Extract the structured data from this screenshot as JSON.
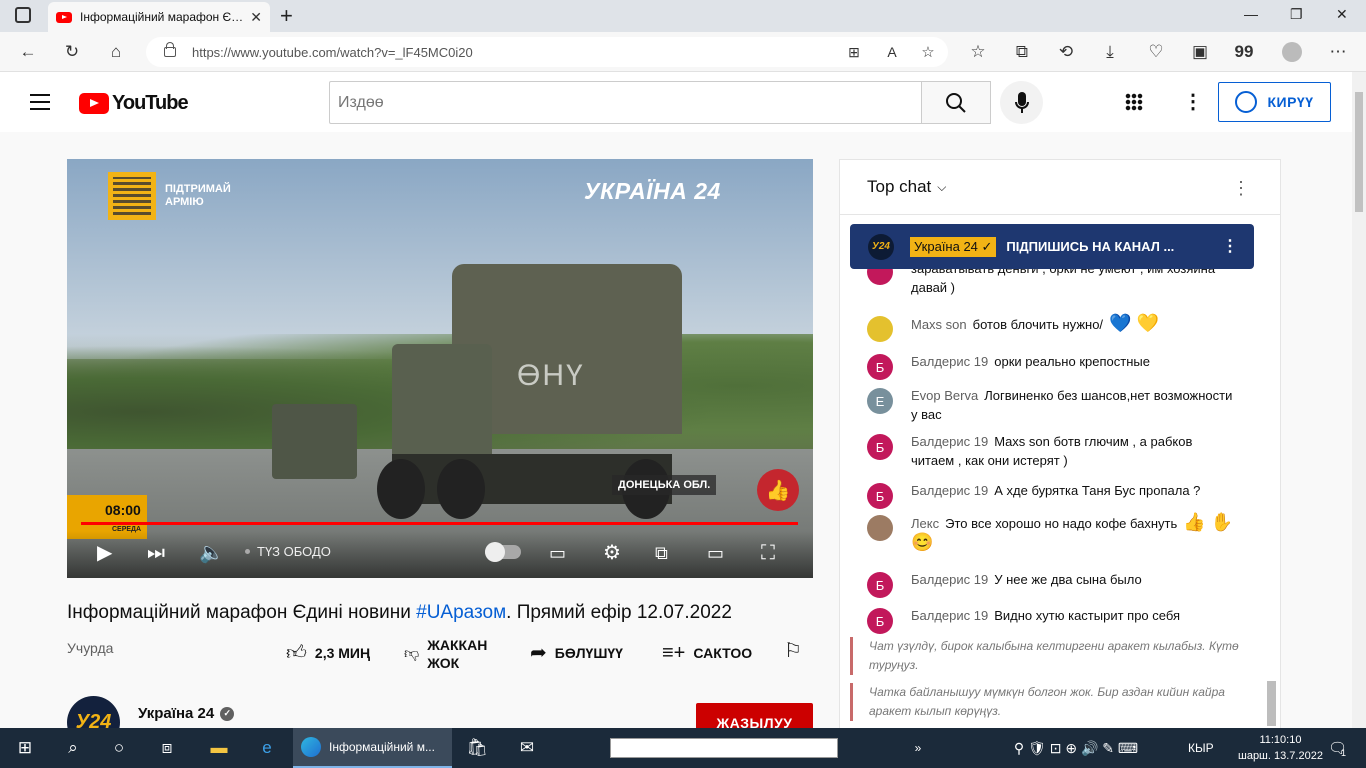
{
  "browser": {
    "tab_title": "Інформаційний марафон Єди",
    "url": "https://www.youtube.com/watch?v=_lF45MC0i20"
  },
  "youtube": {
    "logo_text": "YouTube",
    "search_placeholder": "Издөө",
    "login_label": "КИРҮҮ"
  },
  "video": {
    "qr_text_1": "ПІДТРИМАЙ",
    "qr_text_2": "АРМІЮ",
    "channel_watermark": "УКРАЇНА 24",
    "region": "ДОНЕЦЬКА ОБЛ.",
    "truck_label": "ӨНҮ",
    "overlay_time": "08:00",
    "overlay_day": "СЕРЕДА",
    "live_label": "ТҮЗ ОБОДО",
    "title_prefix": "Інформаційний марафон Єдині новини ",
    "title_tag": "#UAразом",
    "title_suffix": ". Прямий ефір 12.07.2022",
    "date_label": "Учурда",
    "likes": "2,3 МИҢ",
    "dislike_label_1": "ЖАККАН",
    "dislike_label_2": "ЖОК",
    "share_label": "БӨЛҮШҮҮ",
    "save_label": "САКТОО",
    "channel_name": "Україна 24",
    "channel_avatar_text": "У24",
    "subscribe_label": "ЖАЗЫЛУУ"
  },
  "chat": {
    "header": "Top chat",
    "pinned": {
      "avatar": "У24",
      "author": "Україна 24 ✓",
      "text": "ПІДПИШИСЬ НА КАНАЛ ..."
    },
    "partial_message": "зараьатывать деньги , орки не умеют , им хозяина давай )",
    "messages": [
      {
        "author": "Maxs son",
        "text": "ботов блочить нужно/",
        "avatar": "",
        "avatar_color": "#e4c12e",
        "emoji": "💙 💛"
      },
      {
        "author": "Балдерис 19",
        "text": "орки реально крепостные",
        "avatar": "Б",
        "avatar_color": "#c2185b",
        "emoji": ""
      },
      {
        "author": "Evop Berva",
        "text": "Логвиненко без шансов,нет возможности у вас",
        "avatar": "E",
        "avatar_color": "#78909c",
        "emoji": ""
      },
      {
        "author": "Балдерис 19",
        "text": "Maxs son ботв глючим , а рабков читаем , как они истерят )",
        "avatar": "Б",
        "avatar_color": "#c2185b",
        "emoji": ""
      },
      {
        "author": "Балдерис 19",
        "text": "А хде бурятка Таня Бус пропала ?",
        "avatar": "Б",
        "avatar_color": "#c2185b",
        "emoji": ""
      },
      {
        "author": "Лекс",
        "text": "Это все хорошо но надо кофе бахнуть",
        "avatar": "",
        "avatar_color": "#9c7b63",
        "emoji": "👍 ✋ 😊"
      },
      {
        "author": "Балдерис 19",
        "text": "У нее же два сына было",
        "avatar": "Б",
        "avatar_color": "#c2185b",
        "emoji": ""
      },
      {
        "author": "Балдерис 19",
        "text": "Видно хутю кастырит про себя",
        "avatar": "Б",
        "avatar_color": "#c2185b",
        "emoji": ""
      }
    ],
    "system_1": "Чат үзүлдү, бирок калыбына келтиргени аракет кылабыз. Күтө туруңуз.",
    "system_2": "Чатка байланышуу мүмкүн болгон жок. Бир аздан кийин кайра аракет кылып көрүңүз."
  },
  "taskbar": {
    "active_window": "Інформаційний м...",
    "language": "КЫР",
    "time": "11:10:10",
    "date": "шарш. 13.7.2022",
    "notifications": "1"
  }
}
